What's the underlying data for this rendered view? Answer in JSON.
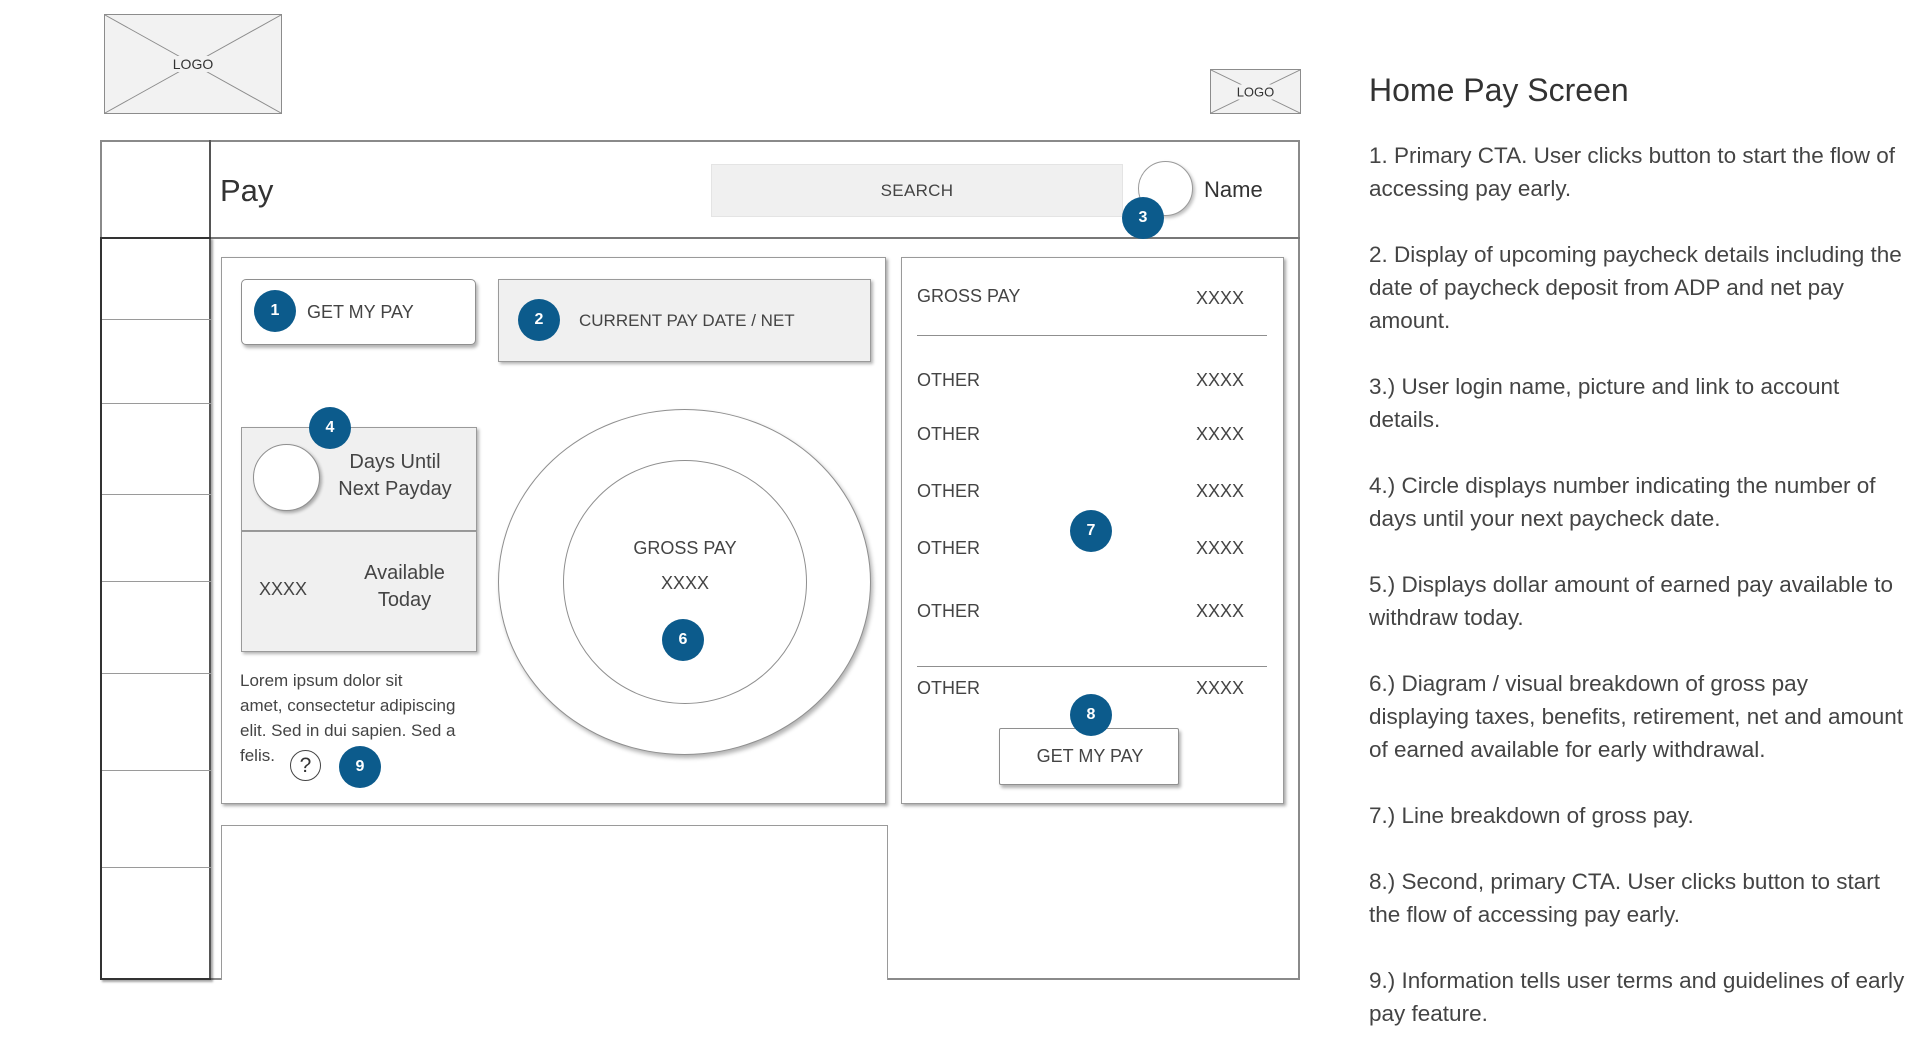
{
  "logos": {
    "left_label": "LOGO",
    "right_label": "LOGO"
  },
  "header": {
    "title": "Pay",
    "search_label": "SEARCH",
    "user_name": "Name"
  },
  "primary_cta": {
    "label": "GET MY PAY",
    "badge": "1"
  },
  "pay_date": {
    "label": "CURRENT PAY DATE / NET",
    "badge": "2"
  },
  "avatar_badge": "3",
  "payday": {
    "label_line1": "Days Until",
    "label_line2": "Next Payday",
    "badge": "4"
  },
  "available": {
    "amount": "XXXX",
    "label_line1": "Available",
    "label_line2": "Today"
  },
  "terms": {
    "text_line1": "Lorem ipsum dolor sit",
    "text_line2": "amet, consectetur adipiscing",
    "text_line3": "elit. Sed in dui sapien. Sed a",
    "text_line4": "felis.",
    "help_glyph": "?",
    "badge": "9"
  },
  "diagram": {
    "label": "GROSS PAY",
    "value": "XXXX",
    "badge": "6"
  },
  "breakdown": {
    "gross_label": "GROSS PAY",
    "gross_value": "XXXX",
    "rows": [
      {
        "label": "OTHER",
        "value": "XXXX"
      },
      {
        "label": "OTHER",
        "value": "XXXX"
      },
      {
        "label": "OTHER",
        "value": "XXXX"
      },
      {
        "label": "OTHER",
        "value": "XXXX"
      },
      {
        "label": "OTHER",
        "value": "XXXX"
      }
    ],
    "total_label": "OTHER",
    "total_value": "XXXX",
    "badge": "7"
  },
  "secondary_cta": {
    "label": "GET MY PAY",
    "badge": "8"
  },
  "notes": {
    "title": "Home Pay Screen",
    "items": [
      "1. Primary CTA. User clicks button to start the flow of accessing pay early.",
      "2. Display of upcoming paycheck details including the date of paycheck deposit from ADP and net pay amount.",
      "3.) User login name, picture and link to account details.",
      "4.) Circle displays number indicating the number of days until your next paycheck date.",
      "5.) Displays dollar amount of earned pay available to withdraw today.",
      "6.) Diagram / visual breakdown of gross pay displaying taxes, benefits, retirement, net and amount of earned available for early withdrawal.",
      "7.) Line breakdown of gross pay.",
      "8.) Second, primary CTA. User clicks button to start the flow of accessing pay early.",
      "9.) Information tells user terms and guidelines of early pay feature."
    ]
  },
  "colors": {
    "badge": "#0c5b8c",
    "panel_fill": "#f0f0f0",
    "border": "#9a9a9a"
  }
}
